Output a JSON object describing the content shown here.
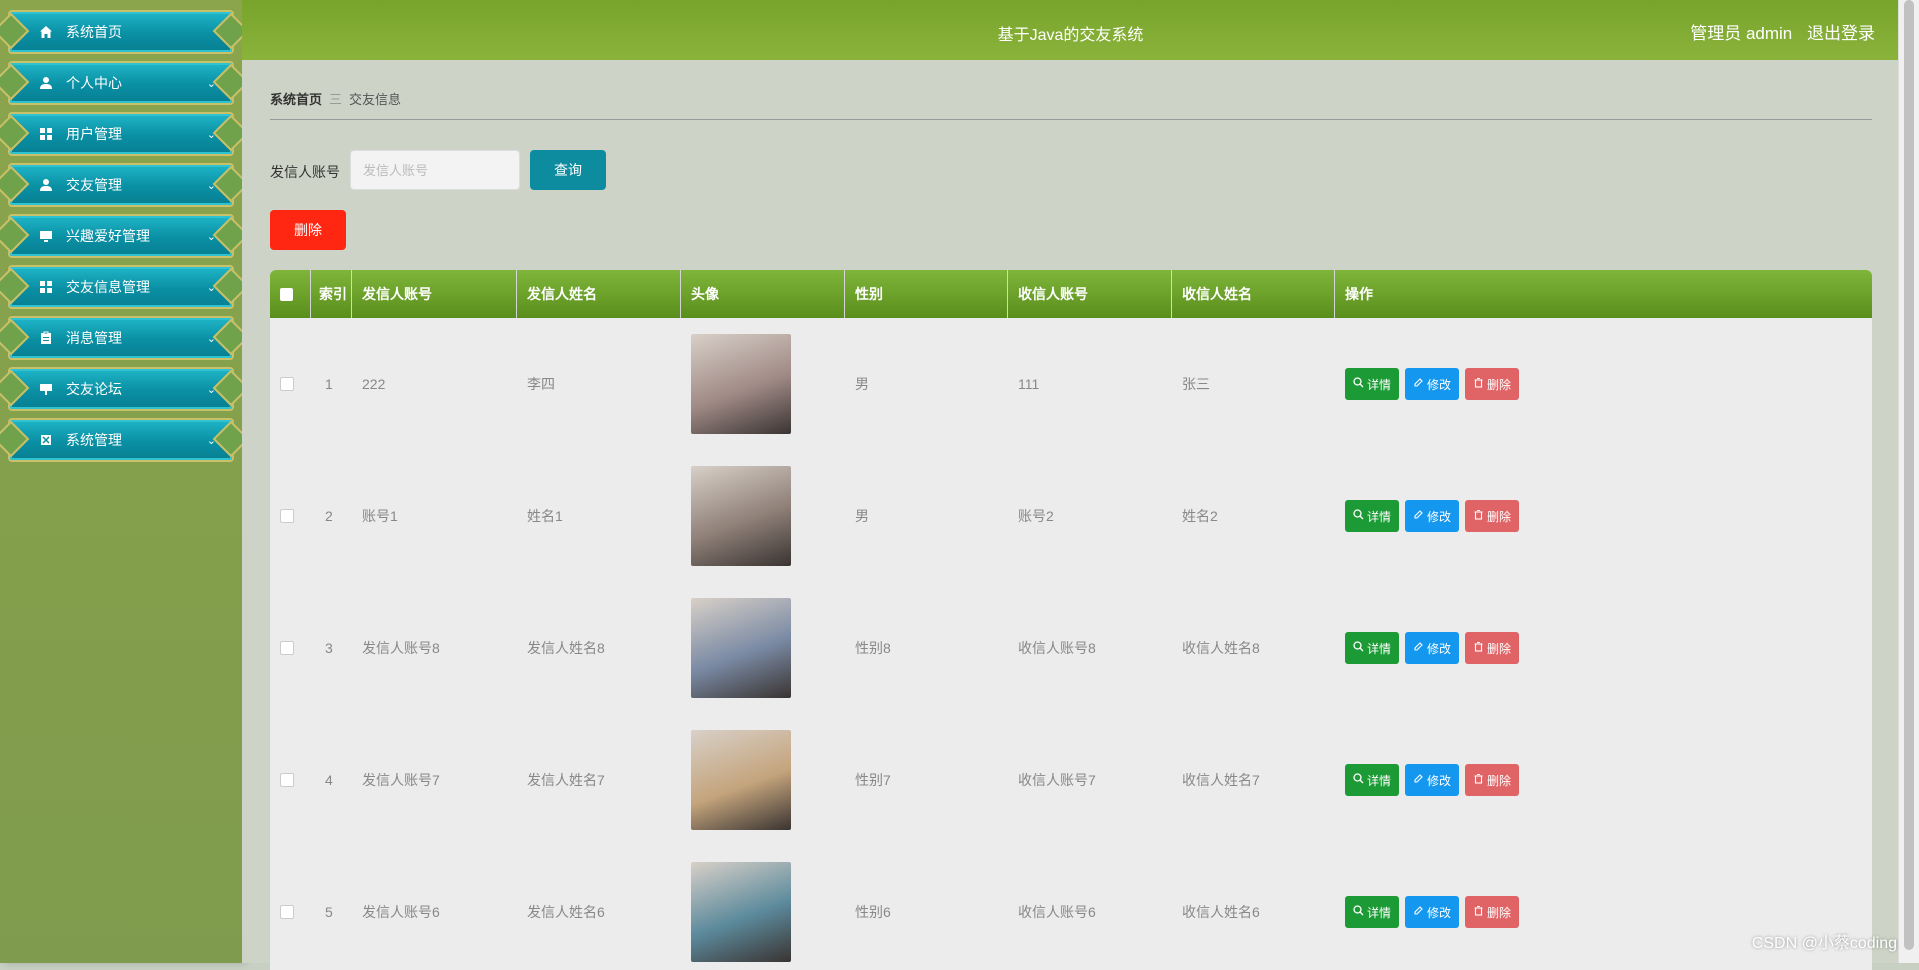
{
  "sidebar": {
    "items": [
      {
        "label": "系统首页",
        "icon": "home-icon",
        "has_chevron": false
      },
      {
        "label": "个人中心",
        "icon": "user-icon",
        "has_chevron": true
      },
      {
        "label": "用户管理",
        "icon": "grid-icon",
        "has_chevron": true
      },
      {
        "label": "交友管理",
        "icon": "user-icon",
        "has_chevron": true
      },
      {
        "label": "兴趣爱好管理",
        "icon": "monitor-icon",
        "has_chevron": true
      },
      {
        "label": "交友信息管理",
        "icon": "grid-icon",
        "has_chevron": true
      },
      {
        "label": "消息管理",
        "icon": "clipboard-icon",
        "has_chevron": true
      },
      {
        "label": "交友论坛",
        "icon": "tv-icon",
        "has_chevron": true
      },
      {
        "label": "系统管理",
        "icon": "box-icon",
        "has_chevron": true
      }
    ]
  },
  "header": {
    "title": "基于Java的交友系统",
    "role": "管理员 admin",
    "logout": "退出登录"
  },
  "breadcrumb": {
    "home": "系统首页",
    "separator": "三",
    "current": "交友信息"
  },
  "search": {
    "label": "发信人账号",
    "placeholder": "发信人账号",
    "button": "查询"
  },
  "toolbar": {
    "delete": "删除"
  },
  "table": {
    "headers": [
      "索引",
      "发信人账号",
      "发信人姓名",
      "头像",
      "性别",
      "收信人账号",
      "收信人姓名",
      "操作"
    ],
    "rows": [
      {
        "index": "1",
        "sender_account": "222",
        "sender_name": "李四",
        "gender": "男",
        "receiver_account": "111",
        "receiver_name": "张三",
        "avatar_color": "#a08a86"
      },
      {
        "index": "2",
        "sender_account": "账号1",
        "sender_name": "姓名1",
        "gender": "男",
        "receiver_account": "账号2",
        "receiver_name": "姓名2",
        "avatar_color": "#8f8078"
      },
      {
        "index": "3",
        "sender_account": "发信人账号8",
        "sender_name": "发信人姓名8",
        "gender": "性别8",
        "receiver_account": "收信人账号8",
        "receiver_name": "收信人姓名8",
        "avatar_color": "#7a8aa4"
      },
      {
        "index": "4",
        "sender_account": "发信人账号7",
        "sender_name": "发信人姓名7",
        "gender": "性别7",
        "receiver_account": "收信人账号7",
        "receiver_name": "收信人姓名7",
        "avatar_color": "#c4a47c"
      },
      {
        "index": "5",
        "sender_account": "发信人账号6",
        "sender_name": "发信人姓名6",
        "gender": "性别6",
        "receiver_account": "收信人账号6",
        "receiver_name": "收信人姓名6",
        "avatar_color": "#5c8a9c"
      }
    ],
    "actions": {
      "detail": "详情",
      "edit": "修改",
      "delete": "删除"
    }
  },
  "watermark": "CSDN @小蔡coding",
  "colors": {
    "header": "#82ab34",
    "sidebar_bg": "#849f4d",
    "menu_item": "#0e96aa",
    "query_button": "#0d8ca0",
    "delete_button": "#ff2612",
    "detail_button": "#1c9a35",
    "edit_button": "#1497ef",
    "row_delete_button": "#e06466"
  }
}
